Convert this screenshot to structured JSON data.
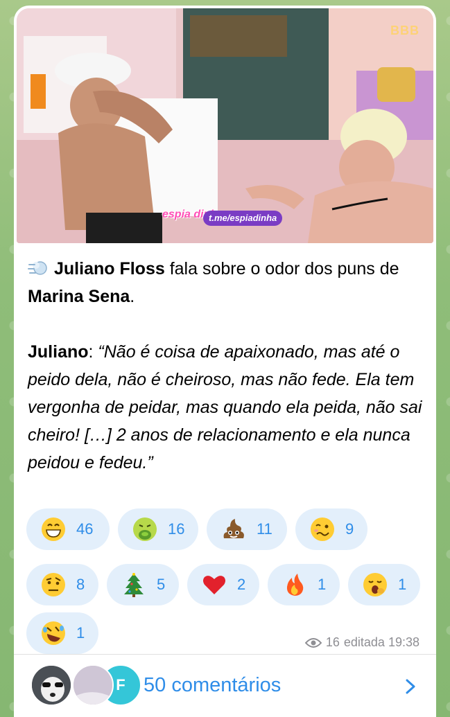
{
  "media": {
    "watermark_logo": "espia dinha",
    "watermark_url": "t.me/espiadinha",
    "channel_tag": "BBB"
  },
  "message": {
    "lead_icon": "dashing-away-emoji",
    "line1_name": "Juliano Floss",
    "line1_rest": " fala sobre o odor dos puns de ",
    "line1_name2": "Marina Sena",
    "line1_end": ".",
    "quote_speaker": "Juliano",
    "quote_sep": ": ",
    "quote_text": "“Não é coisa de apaixonado, mas até o peido dela, não é cheiroso, mas não fede. Ela tem vergonha de peidar, mas quando ela peida, não sai cheiro! […] 2 anos de relacionamento e ela nunca peidou e fedeu.”"
  },
  "reactions": [
    {
      "icon": "grinning-face-emoji",
      "count": "46"
    },
    {
      "icon": "vomiting-face-emoji",
      "count": "16"
    },
    {
      "icon": "pile-of-poo-emoji",
      "count": "11"
    },
    {
      "icon": "woozy-face-emoji",
      "count": "9"
    },
    {
      "icon": "raised-eyebrow-face-emoji",
      "count": "8"
    },
    {
      "icon": "christmas-tree-emoji",
      "count": "5"
    },
    {
      "icon": "red-heart-emoji",
      "count": "2"
    },
    {
      "icon": "fire-emoji",
      "count": "1"
    },
    {
      "icon": "yawning-face-emoji",
      "count": "1"
    },
    {
      "icon": "rolling-laughing-emoji",
      "count": "1"
    }
  ],
  "meta": {
    "views": "16",
    "edited_time": "editada 19:38"
  },
  "comments": {
    "avatar3_letter": "F",
    "label": "50 comentários"
  },
  "colors": {
    "accent": "#2f8de8",
    "reaction_bg": "#e3effb",
    "chat_bg": "#8fbd79"
  }
}
